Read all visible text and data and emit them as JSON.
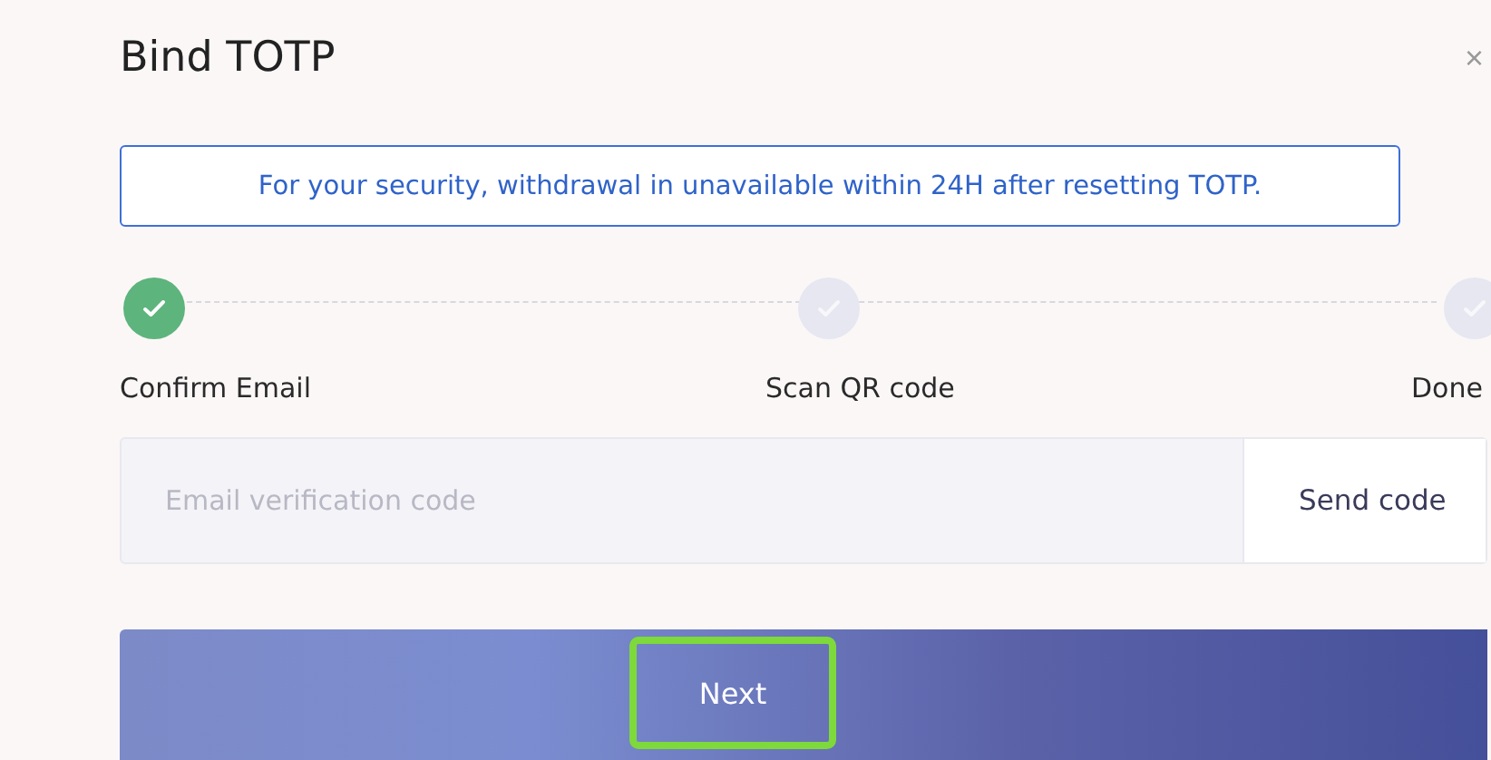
{
  "dialog": {
    "title": "Bind TOTP",
    "close": "×"
  },
  "notice": "For your security, withdrawal in unavailable within 24H after resetting TOTP.",
  "steps": [
    {
      "label": "Confirm Email",
      "done": true
    },
    {
      "label": "Scan QR code",
      "done": false
    },
    {
      "label": "Done",
      "done": false
    }
  ],
  "code_field": {
    "placeholder": "Email verification code",
    "button": "Send code"
  },
  "next_button": {
    "label": "Next",
    "highlighted": true
  }
}
